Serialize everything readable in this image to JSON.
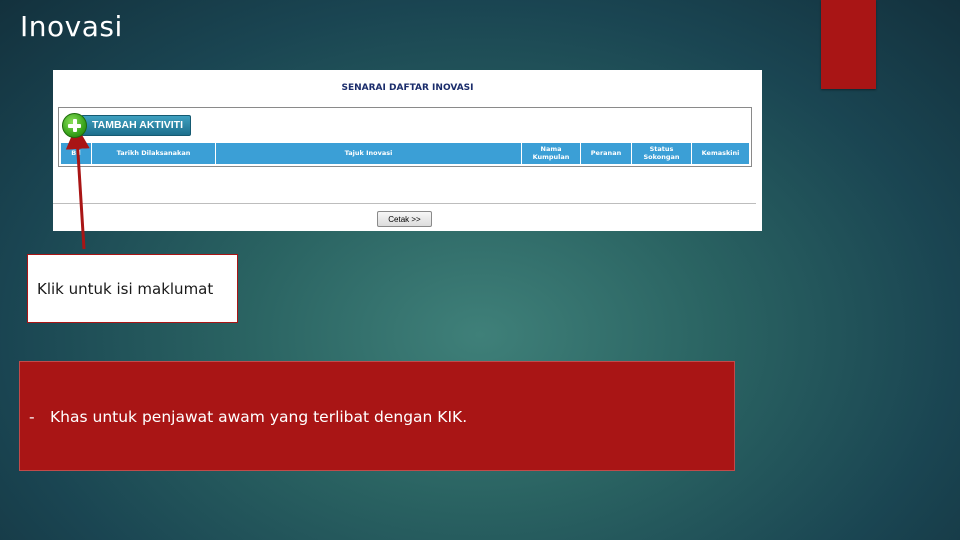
{
  "slide": {
    "title": "Inovasi"
  },
  "screenshot": {
    "title": "SENARAI DAFTAR INOVASI",
    "add_button_label": "TAMBAH AKTIVITI",
    "columns": [
      "Bil",
      "Tarikh Dilaksanakan",
      "Tajuk Inovasi",
      "Nama Kumpulan",
      "Peranan",
      "Status Sokongan",
      "Kemaskini"
    ],
    "print_button_label": "Cetak >>"
  },
  "callout": {
    "text": "Klik untuk isi maklumat"
  },
  "note": {
    "bullet": "-",
    "text": "Khas untuk penjawat awam yang terlibat dengan KIK."
  },
  "colors": {
    "accent_red": "#a91515",
    "header_blue": "#3b9fd6",
    "add_button_green": "#3aa41c",
    "add_button_teal": "#1d6f8d",
    "title_navy": "#1a2c6b"
  }
}
